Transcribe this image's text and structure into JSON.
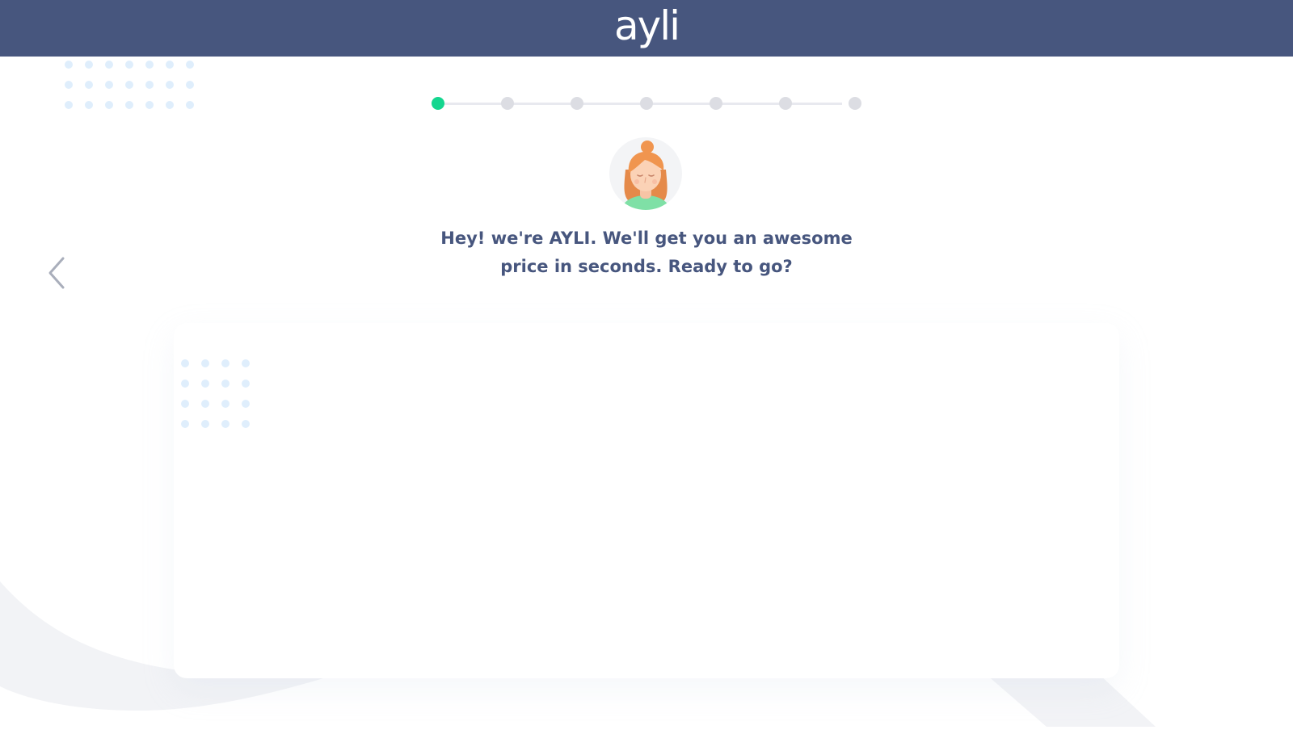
{
  "header": {
    "logo_text": "ayli",
    "background_color": "#47567e"
  },
  "progress": {
    "total_steps": 7,
    "current_step": 1,
    "active_color": "#14d68f",
    "inactive_color": "#dcdde3"
  },
  "assistant": {
    "avatar_icon": "assistant-avatar-icon",
    "message_line1": "Hey! we're AYLI. We'll get you an awesome",
    "message_line2": "price in seconds. Ready to go?"
  },
  "navigation": {
    "back_icon": "chevron-left-icon"
  },
  "colors": {
    "text_primary": "#47567e",
    "accent": "#14d68f",
    "dot_pattern": "#dfeefc"
  }
}
